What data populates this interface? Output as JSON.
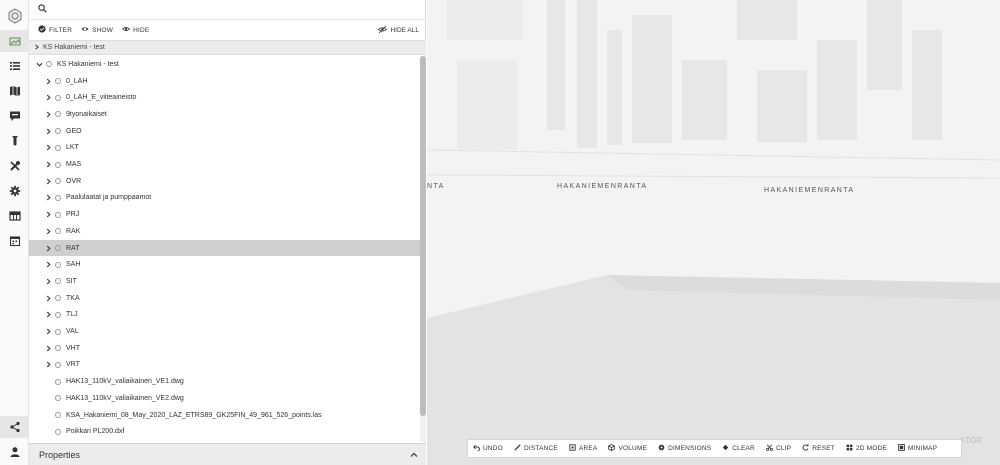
{
  "search": {
    "placeholder": "",
    "value": ""
  },
  "toolbar": {
    "filter_label": "FILTER",
    "show_label": "SHOW",
    "hide_label": "HIDE",
    "hide_all_label": "HIDE ALL"
  },
  "breadcrumb": {
    "label": "KS Hakaniemi - test"
  },
  "tree": {
    "root": {
      "label": "KS Hakaniemi - test"
    },
    "items": [
      {
        "label": "0_LAH",
        "has_children": true
      },
      {
        "label": "0_LAH_E_viiteaineisto",
        "has_children": true
      },
      {
        "label": "9tyonaikaiset",
        "has_children": true
      },
      {
        "label": "GEO",
        "has_children": true
      },
      {
        "label": "LKT",
        "has_children": true
      },
      {
        "label": "MAS",
        "has_children": true
      },
      {
        "label": "OVR",
        "has_children": true
      },
      {
        "label": "Paalulaatat ja pumppaamot",
        "has_children": true
      },
      {
        "label": "PRJ",
        "has_children": true
      },
      {
        "label": "RAK",
        "has_children": true
      },
      {
        "label": "RAT",
        "has_children": true,
        "highlighted": true
      },
      {
        "label": "SAH",
        "has_children": true
      },
      {
        "label": "SIT",
        "has_children": true
      },
      {
        "label": "TKA",
        "has_children": true
      },
      {
        "label": "TLJ",
        "has_children": true
      },
      {
        "label": "VAL",
        "has_children": true
      },
      {
        "label": "VHT",
        "has_children": true
      },
      {
        "label": "VRT",
        "has_children": true
      },
      {
        "label": "HAK13_110kV_valiaikainen_VE1.dwg",
        "has_children": false
      },
      {
        "label": "HAK13_110kV_valiaikainen_VE2.dwg",
        "has_children": false
      },
      {
        "label": "KSA_Hakaniemi_08_May_2020_LAZ_ETRS89_GK25FIN_49_961_526_points.las",
        "has_children": false
      },
      {
        "label": "Poikkari PL200.dxf",
        "has_children": false
      }
    ]
  },
  "properties": {
    "label": "Properties"
  },
  "viewport": {
    "street_labels": [
      "NTA",
      "HAKANIEMENRANTA",
      "HAKANIEMENRANTA"
    ],
    "vendor_text": "KTOR"
  },
  "bottom_toolbar": {
    "undo_label": "UNDO",
    "distance_label": "DISTANCE",
    "area_label": "AREA",
    "volume_label": "VOLUME",
    "dimensions_label": "DIMENSIONS",
    "clear_label": "CLEAR",
    "clip_label": "CLIP",
    "reset_label": "RESET",
    "mode_2d_label": "2D MODE",
    "minimap_label": "MINIMAP"
  },
  "colors": {
    "highlight_row": "#cfcfcf",
    "rail_active": "#e6e6e6",
    "viewport_bg": "#f3f3f3"
  }
}
